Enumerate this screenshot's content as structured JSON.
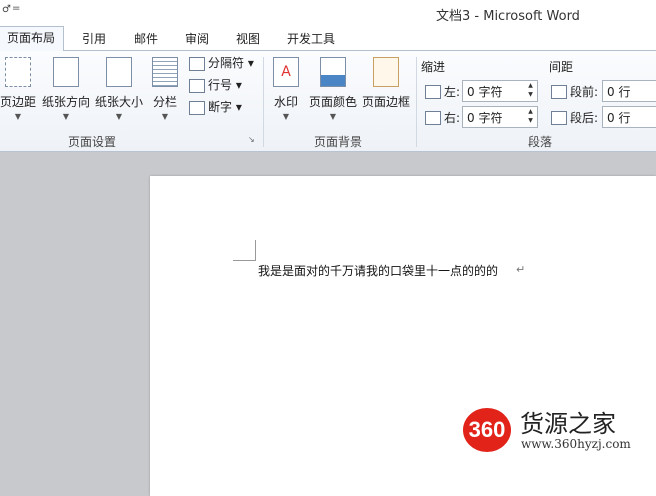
{
  "titlebar": {
    "window_title": "文档3  -  Microsoft Word",
    "qat_fragment": "♂",
    "qat_dropdown": "="
  },
  "tabs": [
    {
      "label": "页面布局",
      "active": true
    },
    {
      "label": "引用"
    },
    {
      "label": "邮件"
    },
    {
      "label": "审阅"
    },
    {
      "label": "视图"
    },
    {
      "label": "开发工具"
    }
  ],
  "page_setup": {
    "margins": "页边距",
    "orientation": "纸张方向",
    "size": "纸张大小",
    "columns": "分栏",
    "breaks": "分隔符 ▾",
    "line_numbers": "行号 ▾",
    "hyphenation": "断字 ▾",
    "group_label": "页面设置"
  },
  "page_background": {
    "watermark": "水印",
    "page_color": "页面颜色",
    "page_borders": "页面边框",
    "group_label": "页面背景"
  },
  "paragraph": {
    "indent_label": "缩进",
    "spacing_label": "间距",
    "indent_left_label": "左:",
    "indent_left_value": "0 字符",
    "indent_right_label": "右:",
    "indent_right_value": "0 字符",
    "spacing_before_label": "段前:",
    "spacing_before_value": "0 行",
    "spacing_after_label": "段后:",
    "spacing_after_value": "0 行",
    "group_label": "段落"
  },
  "document": {
    "text": "我是是面对的千万请我的口袋里十一点的的的",
    "paragraph_mark": "↵"
  },
  "watermark_brand": {
    "badge": "360",
    "name": "货源之家",
    "url": "www.360hyzj.com"
  }
}
